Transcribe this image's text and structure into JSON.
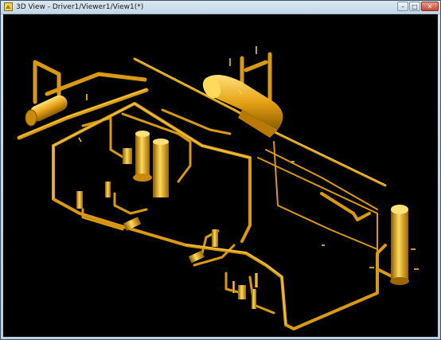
{
  "window": {
    "title": "3D View - Driver1/Viewer1/View1(*)",
    "controls": {
      "minimize": "–",
      "maximize": "□",
      "close": "✕"
    }
  },
  "viewport": {
    "background": "#000000",
    "model_color": "#e8a615",
    "highlight_color": "#ffd95a",
    "shadow_color": "#8a5a00",
    "content": "3D plant piping model"
  }
}
